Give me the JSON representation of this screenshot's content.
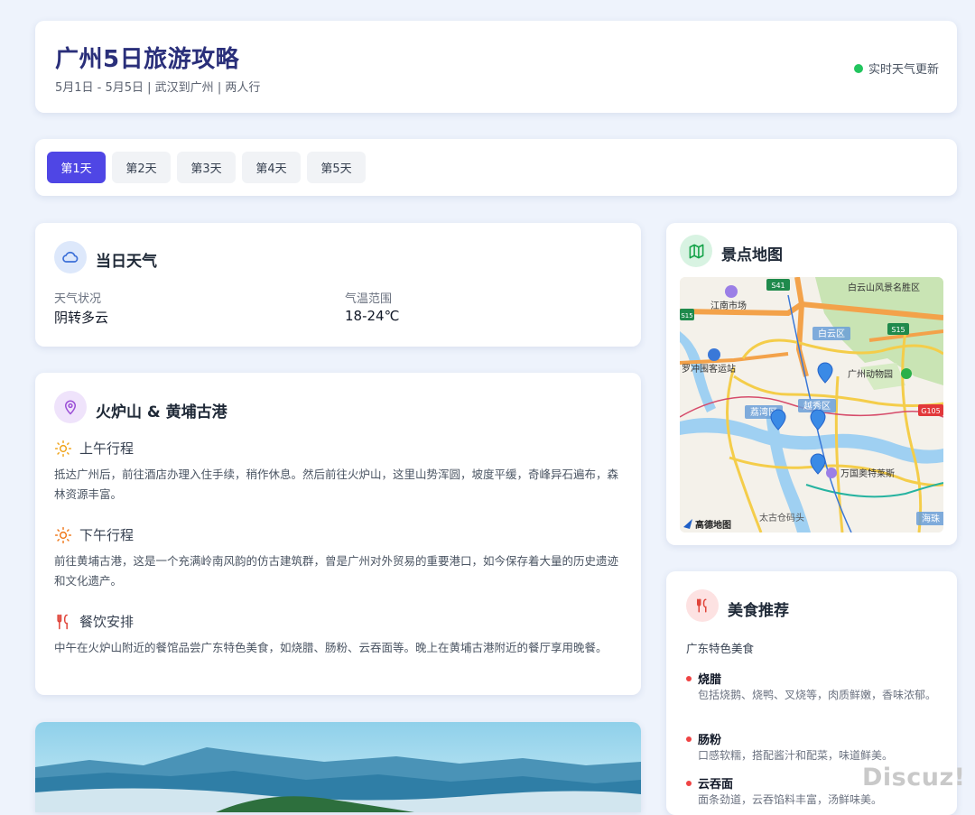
{
  "header": {
    "title": "广州5日旅游攻略",
    "subtitle": "5月1日 - 5月5日 | 武汉到广州 | 两人行",
    "live_status": "实时天气更新"
  },
  "tabs": [
    {
      "label": "第1天",
      "active": true
    },
    {
      "label": "第2天",
      "active": false
    },
    {
      "label": "第3天",
      "active": false
    },
    {
      "label": "第4天",
      "active": false
    },
    {
      "label": "第5天",
      "active": false
    }
  ],
  "weather": {
    "title": "当日天气",
    "condition_label": "天气状况",
    "condition_value": "阴转多云",
    "temp_label": "气温范围",
    "temp_value": "18-24℃"
  },
  "itinerary": {
    "title": "火炉山 & 黄埔古港",
    "morning_title": "上午行程",
    "morning_text": "抵达广州后，前往酒店办理入住手续，稍作休息。然后前往火炉山，这里山势浑圆，坡度平缓，奇峰异石遍布，森林资源丰富。",
    "afternoon_title": "下午行程",
    "afternoon_text": "前往黄埔古港，这是一个充满岭南风韵的仿古建筑群，曾是广州对外贸易的重要港口，如今保存着大量的历史遗迹和文化遗产。",
    "meal_title": "餐饮安排",
    "meal_text": "中午在火炉山附近的餐馆品尝广东特色美食，如烧腊、肠粉、云吞面等。晚上在黄埔古港附近的餐厅享用晚餐。"
  },
  "map": {
    "title": "景点地图",
    "labels": {
      "baiyunshan": "白云山风景名胜区",
      "jiangnan": "江南市场",
      "baiyunqu": "白云区",
      "luochong": "罗冲围客运站",
      "zoo": "广州动物园",
      "yuexiu": "越秀区",
      "liwan": "荔湾区",
      "wanguo": "万国奥特莱斯",
      "taigu": "太古仓码头",
      "haizhu": "海珠",
      "road_s41": "S41",
      "road_s15a": "S15",
      "road_s15b": "S15",
      "road_g105": "G105",
      "brand": "高德地图"
    }
  },
  "food": {
    "title": "美食推荐",
    "subtitle": "广东特色美食",
    "items": [
      {
        "name": "烧腊",
        "desc": "包括烧鹅、烧鸭、叉烧等，肉质鲜嫩，香味浓郁。"
      },
      {
        "name": "肠粉",
        "desc": "口感软糯，搭配酱汁和配菜，味道鲜美。"
      },
      {
        "name": "云吞面",
        "desc": "面条劲道，云吞馅料丰富，汤鲜味美。"
      }
    ]
  },
  "watermark": "Discuz!",
  "colors": {
    "accent": "#4f46e5",
    "title": "#2a2f7a",
    "live_dot": "#22c55e",
    "food_bullet": "#ef4444",
    "page_bg": "#eef3fc"
  }
}
